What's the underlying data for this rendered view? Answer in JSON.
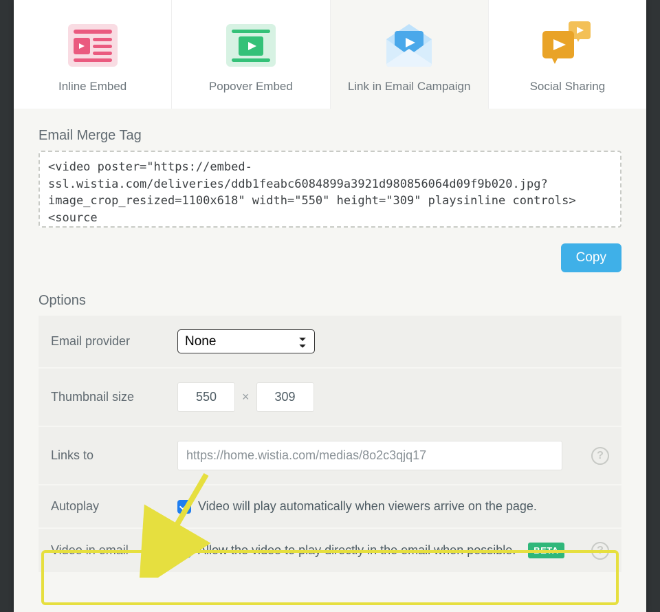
{
  "tabs": {
    "inline": {
      "label": "Inline Embed"
    },
    "popover": {
      "label": "Popover Embed"
    },
    "email": {
      "label": "Link in Email Campaign"
    },
    "social": {
      "label": "Social Sharing"
    }
  },
  "merge": {
    "title": "Email Merge Tag",
    "code": "<video poster=\"https://embed-ssl.wistia.com/deliveries/ddb1feabc6084899a3921d980856064d09f9b020.jpg?image_crop_resized=1100x618\" width=\"550\" height=\"309\" playsinline controls><source",
    "copy_label": "Copy"
  },
  "options": {
    "title": "Options",
    "provider": {
      "label": "Email provider",
      "value": "None"
    },
    "thumbnail": {
      "label": "Thumbnail size",
      "width": "550",
      "height": "309"
    },
    "links": {
      "label": "Links to",
      "value": "https://home.wistia.com/medias/8o2c3qjq17"
    },
    "autoplay": {
      "label": "Autoplay",
      "checked": true,
      "desc": "Video will play automatically when viewers arrive on the page."
    },
    "video_in_email": {
      "label": "Video in email",
      "checked": true,
      "desc": "Allow the video to play directly in the email when possible.",
      "badge": "BETA"
    }
  }
}
